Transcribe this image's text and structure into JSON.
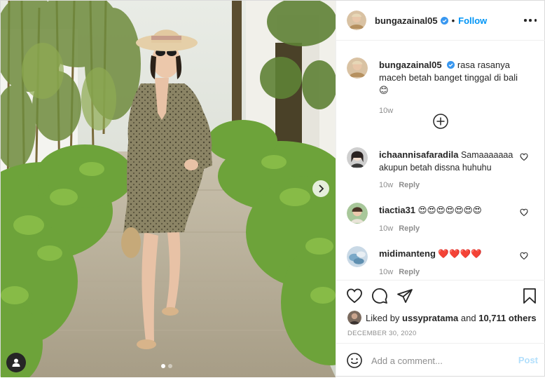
{
  "post": {
    "author": "bungazainal05",
    "follow_label": "Follow",
    "separator": "•",
    "caption_text": "rasa rasanya maceh betah banget tinggal di bali",
    "caption_emoji": "😊",
    "caption_time": "10w",
    "photo_count": 2,
    "active_photo": 1
  },
  "comments": [
    {
      "user": "ichaannisafaradila",
      "text": "Samaaaaaaa akupun betah dissna huhuhu",
      "time": "10w",
      "reply_label": "Reply"
    },
    {
      "user": "tiactia31",
      "text": "😍😍😍😍😍😍😍",
      "time": "10w",
      "reply_label": "Reply"
    },
    {
      "user": "midimanteng",
      "text": "❤️❤️❤️❤️",
      "time": "10w",
      "reply_label": "Reply"
    }
  ],
  "likes": {
    "prefix": "Liked by",
    "user": "ussypratama",
    "and": "and",
    "count_text": "10,711 others"
  },
  "date": "DECEMBER 30, 2020",
  "add_comment": {
    "placeholder": "Add a comment...",
    "post_label": "Post"
  },
  "icons": [
    "chevron-right-icon",
    "user-tag-icon",
    "verified-badge-icon",
    "more-options-icon",
    "plus-circle-icon",
    "heart-icon",
    "comment-icon",
    "share-icon",
    "bookmark-icon",
    "emoji-icon"
  ],
  "colors": {
    "link": "#0095f6",
    "verified": "#3897f0",
    "post_disabled": "#b2dffc",
    "muted": "#8e8e8e"
  }
}
